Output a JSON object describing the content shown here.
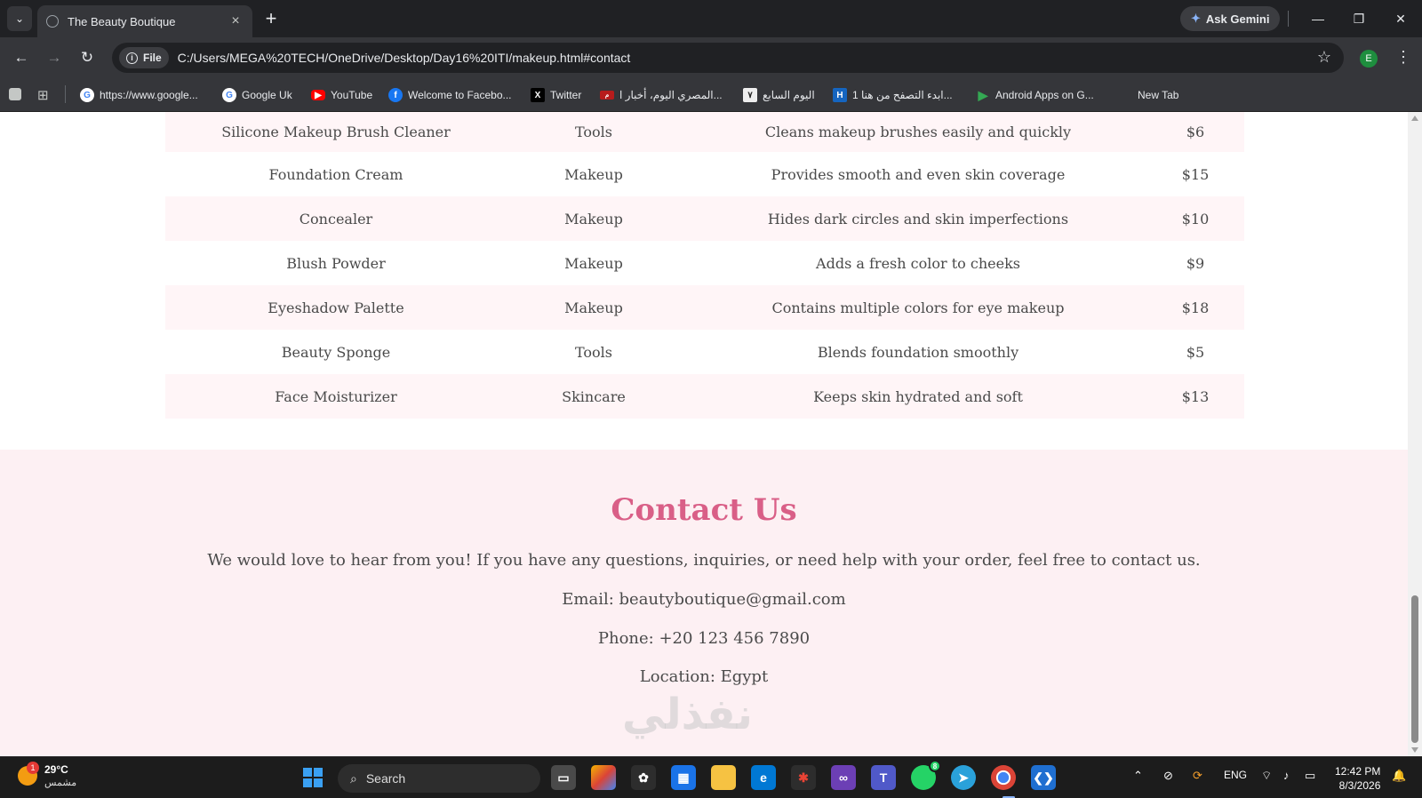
{
  "browser": {
    "tab_title": "The Beauty Boutique",
    "tab_close": "×",
    "new_tab": "+",
    "gemini_label": "Ask Gemini",
    "file_chip": "File",
    "url": "C:/Users/MEGA%20TECH/OneDrive/Desktop/Day16%20ITI/makeup.html#contact",
    "profile_initial": "E"
  },
  "bookmarks": [
    {
      "label": "https://www.google...",
      "icon": "google-icon",
      "color": "#4285f4"
    },
    {
      "label": "Google Uk",
      "icon": "google-icon",
      "color": "#4285f4"
    },
    {
      "label": "YouTube",
      "icon": "youtube-icon",
      "color": "#ff0000"
    },
    {
      "label": "Welcome to Facebo...",
      "icon": "facebook-icon",
      "color": "#1877f2"
    },
    {
      "label": "Twitter",
      "icon": "x-icon",
      "color": "#000000"
    },
    {
      "label": "المصري اليوم، أخبار ا...",
      "icon": "news-icon",
      "color": "#b71c1c"
    },
    {
      "label": "اليوم السابع",
      "icon": "news-icon",
      "color": "#222222"
    },
    {
      "label": "ابدء التصفح من هنا 1...",
      "icon": "bookmark-icon",
      "color": "#1565c0"
    },
    {
      "label": "Android Apps on G...",
      "icon": "play-store-icon",
      "color": "#34a853"
    },
    {
      "label": "New Tab",
      "icon": "",
      "color": ""
    }
  ],
  "products": [
    {
      "name": "Silicone Makeup Brush Cleaner",
      "category": "Tools",
      "description": "Cleans makeup brushes easily and quickly",
      "price": "$6"
    },
    {
      "name": "Foundation Cream",
      "category": "Makeup",
      "description": "Provides smooth and even skin coverage",
      "price": "$15"
    },
    {
      "name": "Concealer",
      "category": "Makeup",
      "description": "Hides dark circles and skin imperfections",
      "price": "$10"
    },
    {
      "name": "Blush Powder",
      "category": "Makeup",
      "description": "Adds a fresh color to cheeks",
      "price": "$9"
    },
    {
      "name": "Eyeshadow Palette",
      "category": "Makeup",
      "description": "Contains multiple colors for eye makeup",
      "price": "$18"
    },
    {
      "name": "Beauty Sponge",
      "category": "Tools",
      "description": "Blends foundation smoothly",
      "price": "$5"
    },
    {
      "name": "Face Moisturizer",
      "category": "Skincare",
      "description": "Keeps skin hydrated and soft",
      "price": "$13"
    }
  ],
  "contact": {
    "heading": "Contact Us",
    "intro": "We would love to hear from you! If you have any questions, inquiries, or need help with your order, feel free to contact us.",
    "email": "Email: beautyboutique@gmail.com",
    "phone": "Phone: +20 123 456 7890",
    "location": "Location: Egypt",
    "accent_color": "#d95f87",
    "watermark": "نفذلي"
  },
  "taskbar": {
    "weather_temp": "29°C",
    "weather_condition": "مشمس",
    "weather_badge": "1",
    "search_placeholder": "Search",
    "language": "ENG",
    "time": "12:42 PM",
    "date": "8/3/2026",
    "whatsapp_badge": "8"
  }
}
